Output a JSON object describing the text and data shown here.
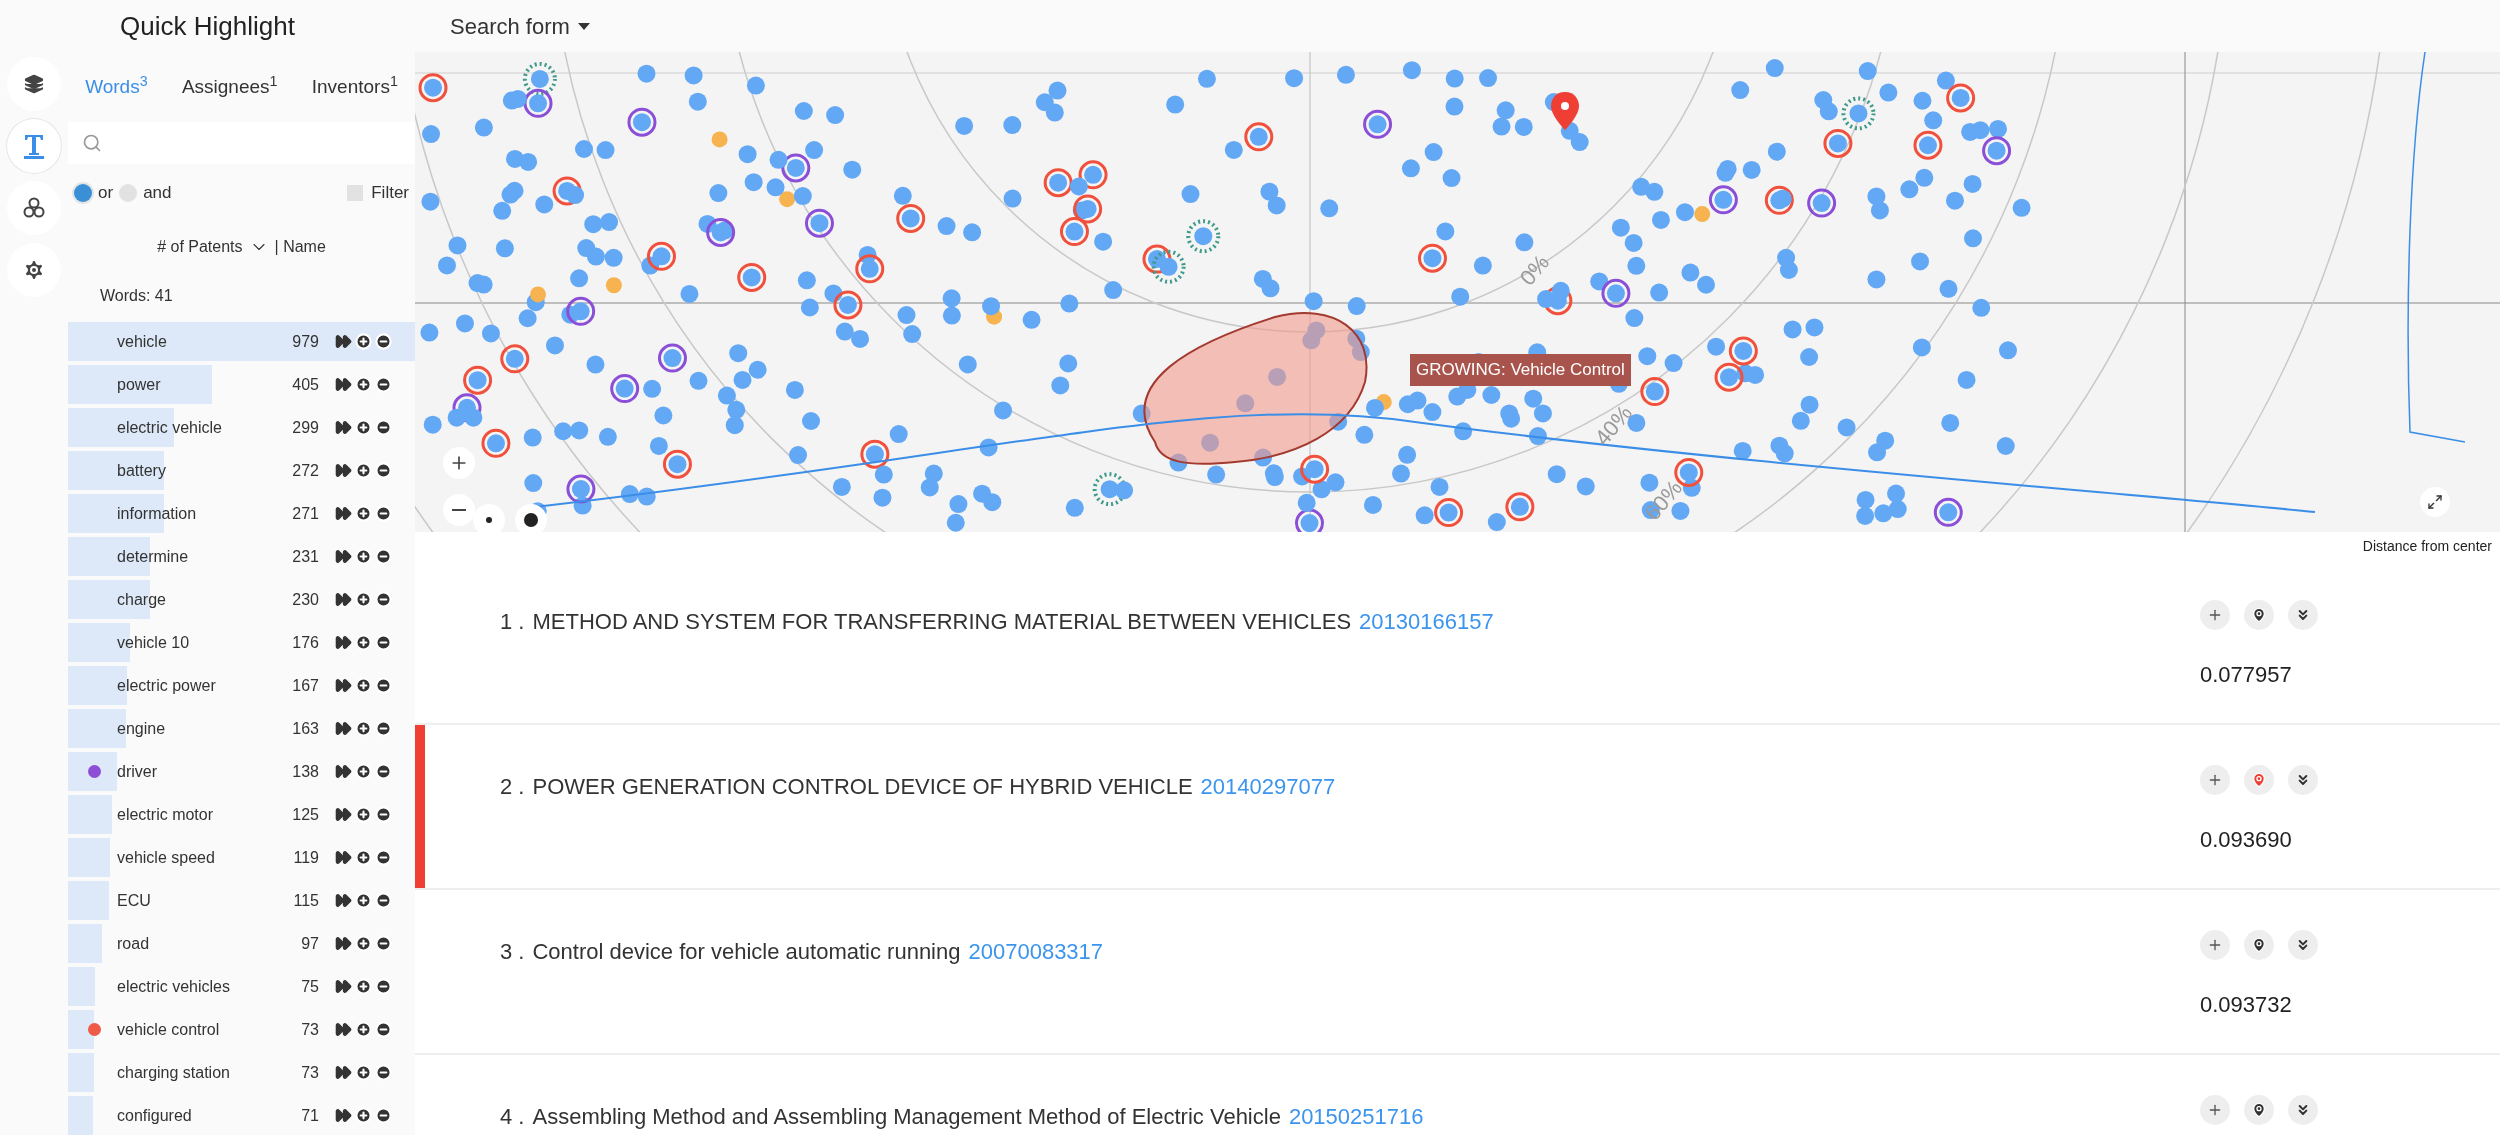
{
  "sidebar": {
    "title": "Quick Highlight",
    "rail": [
      {
        "kind": "layers",
        "selected": false
      },
      {
        "kind": "text",
        "selected": true
      },
      {
        "kind": "circles",
        "selected": false
      },
      {
        "kind": "settings",
        "selected": false
      }
    ],
    "tabs": [
      {
        "label": "Words$^{3}$",
        "selected": true
      },
      {
        "label": "Assignees$^{1}$",
        "selected": false
      },
      {
        "label": "Inventors$^{1}$",
        "selected": false
      }
    ],
    "match_options": [
      {
        "label": "or",
        "selected": true
      },
      {
        "label": "and",
        "selected": false
      }
    ],
    "filter": {
      "label": "Filter",
      "checked": false
    },
    "sort": {
      "primary": "# of Patents",
      "secondary": "| Name"
    },
    "count": "Words: 41",
    "words": [
      {
        "name": "vehicle",
        "count": "979",
        "level": 1.0
      },
      {
        "name": "power",
        "count": "405",
        "level": 0.414
      },
      {
        "name": "electric vehicle",
        "count": "299",
        "level": 0.305
      },
      {
        "name": "battery",
        "count": "272",
        "level": 0.278
      },
      {
        "name": "information",
        "count": "271",
        "level": 0.277
      },
      {
        "name": "determine",
        "count": "231",
        "level": 0.236
      },
      {
        "name": "charge",
        "count": "230",
        "level": 0.235
      },
      {
        "name": "vehicle 10",
        "count": "176",
        "level": 0.18
      },
      {
        "name": "electric power",
        "count": "167",
        "level": 0.171
      },
      {
        "name": "engine",
        "count": "163",
        "level": 0.166
      },
      {
        "name": "driver",
        "count": "138",
        "level": 0.141,
        "color": "#8e4fd6"
      },
      {
        "name": "electric motor",
        "count": "125",
        "level": 0.128
      },
      {
        "name": "vehicle speed",
        "count": "119",
        "level": 0.122
      },
      {
        "name": "ECU",
        "count": "115",
        "level": 0.117
      },
      {
        "name": "road",
        "count": "97",
        "level": 0.099
      },
      {
        "name": "electric vehicles",
        "count": "75",
        "level": 0.077
      },
      {
        "name": "vehicle control",
        "count": "73",
        "level": 0.075,
        "color": "#ef5a47"
      },
      {
        "name": "charging station",
        "count": "73",
        "level": 0.075
      },
      {
        "name": "configured",
        "count": "71",
        "level": 0.073
      }
    ]
  },
  "topbar": {
    "label": "Search form"
  },
  "map": {
    "tooltip": "GROWING: Vehicle Control",
    "ring_labels": [
      "0%",
      "40%",
      "60%"
    ],
    "caption": "Distance from center"
  },
  "results": [
    {
      "number": "1 .",
      "title": "METHOD AND SYSTEM FOR TRANSFERRING MATERIAL BETWEEN VEHICLES",
      "id": "20130166157",
      "score": "0.077957",
      "marked": false
    },
    {
      "number": "2 .",
      "title": "POWER GENERATION CONTROL DEVICE OF HYBRID VEHICLE",
      "id": "20140297077",
      "score": "0.093690",
      "marked": true
    },
    {
      "number": "3 .",
      "title": "Control device for vehicle automatic running",
      "id": "20070083317",
      "score": "0.093732",
      "marked": false
    },
    {
      "number": "4 .",
      "title": "Assembling Method and Assembling Management Method of Electric Vehicle",
      "id": "20150251716",
      "marked": false
    }
  ]
}
